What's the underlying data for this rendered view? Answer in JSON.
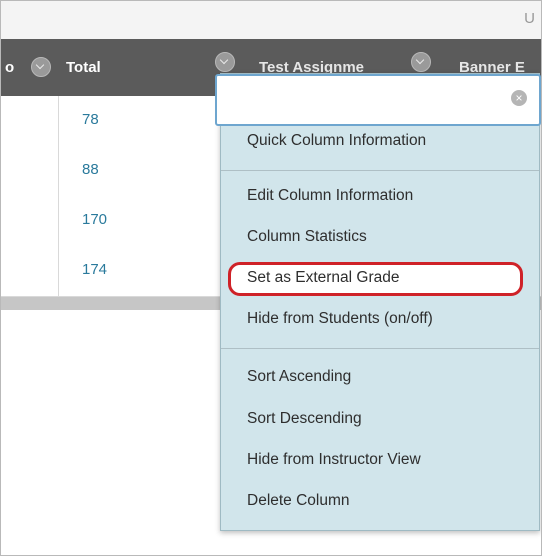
{
  "topbar": {
    "corner_letter": "U"
  },
  "header": {
    "left_fragment": "o",
    "total_label": "Total",
    "col1_label": "Test Assignme",
    "col2_label": "Banner E"
  },
  "rows": [
    {
      "total": "78"
    },
    {
      "total": "88"
    },
    {
      "total": "170"
    },
    {
      "total": "174"
    }
  ],
  "menu": {
    "search_value": "",
    "clear_symbol": "×",
    "items": [
      "Quick Column Information",
      "Edit Column Information",
      "Column Statistics",
      "Set as External Grade",
      "Hide from Students (on/off)",
      "Sort Ascending",
      "Sort Descending",
      "Hide from Instructor View",
      "Delete Column"
    ]
  },
  "colors": {
    "header_bg": "#5b5b5b",
    "menu_bg": "#d1e5eb",
    "link": "#2a7a9c",
    "highlight_ring": "#cf2228"
  }
}
